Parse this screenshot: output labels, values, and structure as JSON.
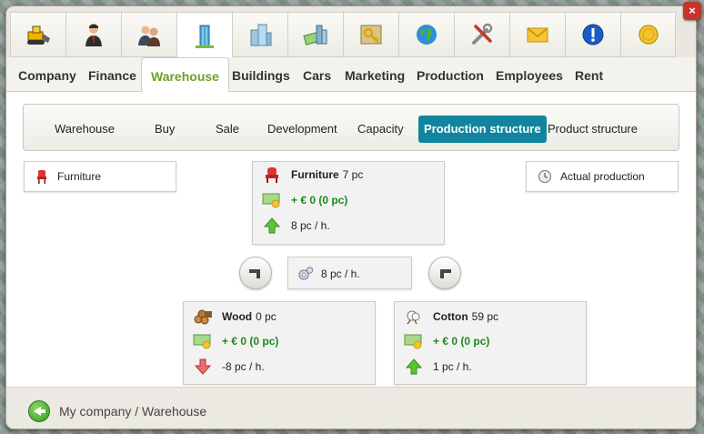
{
  "window": {
    "close_label": "×"
  },
  "icon_tabs": [
    {
      "name": "bulldozer-icon"
    },
    {
      "name": "businessman-icon"
    },
    {
      "name": "people-icon"
    },
    {
      "name": "skyscraper-icon"
    },
    {
      "name": "city-buildings-icon"
    },
    {
      "name": "money-city-icon"
    },
    {
      "name": "map-key-icon"
    },
    {
      "name": "globe-icon"
    },
    {
      "name": "tools-icon"
    },
    {
      "name": "envelope-icon"
    },
    {
      "name": "info-icon"
    },
    {
      "name": "coin-icon"
    }
  ],
  "menu": {
    "company": "Company",
    "finance": "Finance",
    "warehouse": "Warehouse",
    "buildings": "Buildings",
    "cars": "Cars",
    "marketing": "Marketing",
    "production": "Production",
    "employees": "Employees",
    "rent": "Rent"
  },
  "subnav": {
    "warehouse": "Warehouse",
    "buy": "Buy",
    "sale": "Sale",
    "development": "Development",
    "capacity": "Capacity",
    "production_structure": "Production structure",
    "product_structure": "Product structure"
  },
  "left_filter": {
    "label": "Furniture",
    "icon": "chair-icon"
  },
  "right_filter": {
    "label": "Actual production",
    "icon": "clock-icon"
  },
  "product": {
    "name": "Furniture",
    "quantity": "7 pc",
    "money": "+ € 0 (0 pc)",
    "rate": "8 pc / h.",
    "trend": "up"
  },
  "process": {
    "rate": "8 pc / h.",
    "icon": "gears-icon"
  },
  "inputs": [
    {
      "name": "Wood",
      "quantity": "0 pc",
      "money": "+ € 0 (0 pc)",
      "rate": "-8 pc / h.",
      "trend": "down",
      "icon": "logs-icon"
    },
    {
      "name": "Cotton",
      "quantity": "59 pc",
      "money": "+ € 0 (0 pc)",
      "rate": "1 pc / h.",
      "trend": "up",
      "icon": "cotton-icon"
    }
  ],
  "footer": {
    "breadcrumb": "My company / Warehouse"
  }
}
